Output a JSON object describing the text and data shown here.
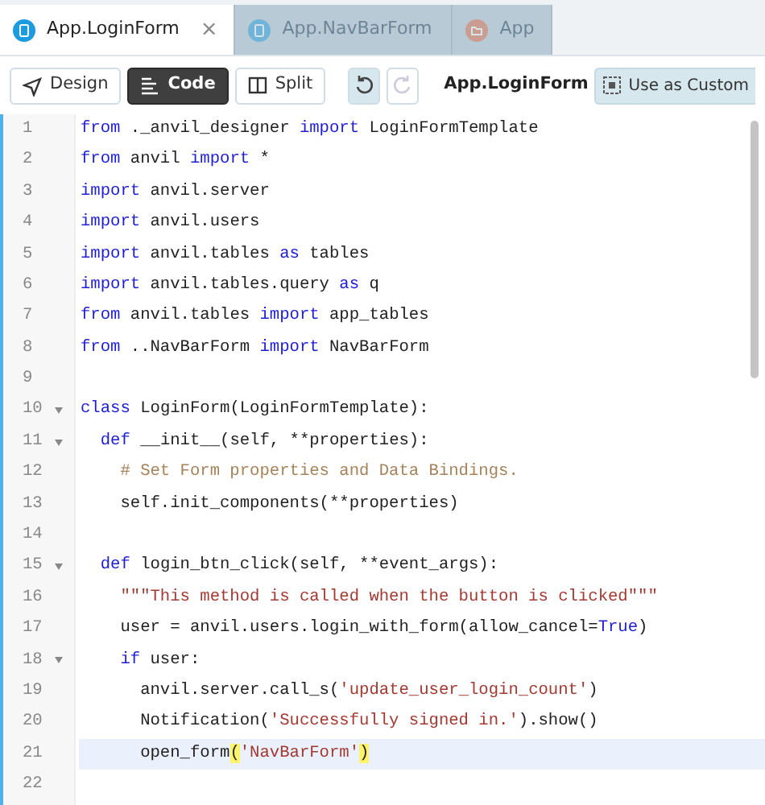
{
  "tabs": [
    {
      "label": "App.LoginForm",
      "kind": "form",
      "selected": true,
      "closable": true
    },
    {
      "label": "App.NavBarForm",
      "kind": "form",
      "selected": false,
      "closable": false
    },
    {
      "label": "App",
      "kind": "folder",
      "selected": false,
      "closable": false
    }
  ],
  "close_glyph": "×",
  "toolbar": {
    "modes": [
      {
        "label": "Design",
        "kind": "design",
        "selected": false
      },
      {
        "label": "Code",
        "kind": "code",
        "selected": true
      },
      {
        "label": "Split",
        "kind": "split",
        "selected": false
      }
    ],
    "undo": {
      "disabled": false
    },
    "redo": {
      "disabled": true
    },
    "form_name": "App.LoginForm",
    "custom_button": "Use as Custom"
  },
  "editor": {
    "lines": [
      {
        "number": "1",
        "fold": false,
        "current": false,
        "tokens": [
          {
            "kind": "kw",
            "text": "from"
          },
          {
            "kind": "plain",
            "text": " ._anvil_designer "
          },
          {
            "kind": "kw",
            "text": "import"
          },
          {
            "kind": "plain",
            "text": " LoginFormTemplate"
          }
        ]
      },
      {
        "number": "2",
        "fold": false,
        "current": false,
        "tokens": [
          {
            "kind": "kw",
            "text": "from"
          },
          {
            "kind": "plain",
            "text": " anvil "
          },
          {
            "kind": "kw",
            "text": "import"
          },
          {
            "kind": "plain",
            "text": " *"
          }
        ]
      },
      {
        "number": "3",
        "fold": false,
        "current": false,
        "tokens": [
          {
            "kind": "kw",
            "text": "import"
          },
          {
            "kind": "plain",
            "text": " anvil.server"
          }
        ]
      },
      {
        "number": "4",
        "fold": false,
        "current": false,
        "tokens": [
          {
            "kind": "kw",
            "text": "import"
          },
          {
            "kind": "plain",
            "text": " anvil.users"
          }
        ]
      },
      {
        "number": "5",
        "fold": false,
        "current": false,
        "tokens": [
          {
            "kind": "kw",
            "text": "import"
          },
          {
            "kind": "plain",
            "text": " anvil.tables "
          },
          {
            "kind": "kw",
            "text": "as"
          },
          {
            "kind": "plain",
            "text": " tables"
          }
        ]
      },
      {
        "number": "6",
        "fold": false,
        "current": false,
        "tokens": [
          {
            "kind": "kw",
            "text": "import"
          },
          {
            "kind": "plain",
            "text": " anvil.tables.query "
          },
          {
            "kind": "kw",
            "text": "as"
          },
          {
            "kind": "plain",
            "text": " q"
          }
        ]
      },
      {
        "number": "7",
        "fold": false,
        "current": false,
        "tokens": [
          {
            "kind": "kw",
            "text": "from"
          },
          {
            "kind": "plain",
            "text": " anvil.tables "
          },
          {
            "kind": "kw",
            "text": "import"
          },
          {
            "kind": "plain",
            "text": " app_tables"
          }
        ]
      },
      {
        "number": "8",
        "fold": false,
        "current": false,
        "tokens": [
          {
            "kind": "kw",
            "text": "from"
          },
          {
            "kind": "plain",
            "text": " ..NavBarForm "
          },
          {
            "kind": "kw",
            "text": "import"
          },
          {
            "kind": "plain",
            "text": " NavBarForm"
          }
        ]
      },
      {
        "number": "9",
        "fold": false,
        "current": false
      },
      {
        "number": "10",
        "fold": true,
        "current": false,
        "tokens": [
          {
            "kind": "kw",
            "text": "class"
          },
          {
            "kind": "plain",
            "text": " LoginForm(LoginFormTemplate):"
          }
        ]
      },
      {
        "number": "11",
        "fold": true,
        "current": false,
        "tokens": [
          {
            "kind": "kw",
            "text": "  def"
          },
          {
            "kind": "plain",
            "text": " __init__(self, **properties):"
          }
        ]
      },
      {
        "number": "12",
        "fold": false,
        "current": false,
        "tokens": [
          {
            "kind": "comment",
            "text": "    # Set Form properties and Data Bindings."
          }
        ]
      },
      {
        "number": "13",
        "fold": false,
        "current": false,
        "tokens": [
          {
            "kind": "plain",
            "text": "    self.init_components(**properties)"
          }
        ]
      },
      {
        "number": "14",
        "fold": false,
        "current": false
      },
      {
        "number": "15",
        "fold": true,
        "current": false,
        "tokens": [
          {
            "kind": "kw",
            "text": "  def"
          },
          {
            "kind": "plain",
            "text": " login_btn_click(self, **event_args):"
          }
        ]
      },
      {
        "number": "16",
        "fold": false,
        "current": false,
        "tokens": [
          {
            "kind": "str",
            "text": "    \"\"\"This method is called when the button is clicked\"\"\""
          }
        ]
      },
      {
        "number": "17",
        "fold": false,
        "current": false,
        "tokens": [
          {
            "kind": "plain",
            "text": "    user = anvil.users.login_with_form(allow_cancel="
          },
          {
            "kind": "kw",
            "text": "True"
          },
          {
            "kind": "plain",
            "text": ")"
          }
        ]
      },
      {
        "number": "18",
        "fold": true,
        "current": false,
        "tokens": [
          {
            "kind": "kw",
            "text": "    if"
          },
          {
            "kind": "plain",
            "text": " user:"
          }
        ]
      },
      {
        "number": "19",
        "fold": false,
        "current": false,
        "tokens": [
          {
            "kind": "plain",
            "text": "      anvil.server.call_s("
          },
          {
            "kind": "str",
            "text": "'update_user_login_count'"
          },
          {
            "kind": "plain",
            "text": ")"
          }
        ]
      },
      {
        "number": "20",
        "fold": false,
        "current": false,
        "tokens": [
          {
            "kind": "plain",
            "text": "      Notification("
          },
          {
            "kind": "str",
            "text": "'Successfully signed in.'"
          },
          {
            "kind": "plain",
            "text": ").show()"
          }
        ]
      },
      {
        "number": "21",
        "fold": false,
        "current": true,
        "tokens": [
          {
            "kind": "plain",
            "text": "      open_form"
          },
          {
            "kind": "match",
            "text": "("
          },
          {
            "kind": "str",
            "text": "'NavBarForm'"
          },
          {
            "kind": "match",
            "text": ")"
          }
        ]
      },
      {
        "number": "22",
        "fold": false,
        "current": false
      }
    ]
  }
}
